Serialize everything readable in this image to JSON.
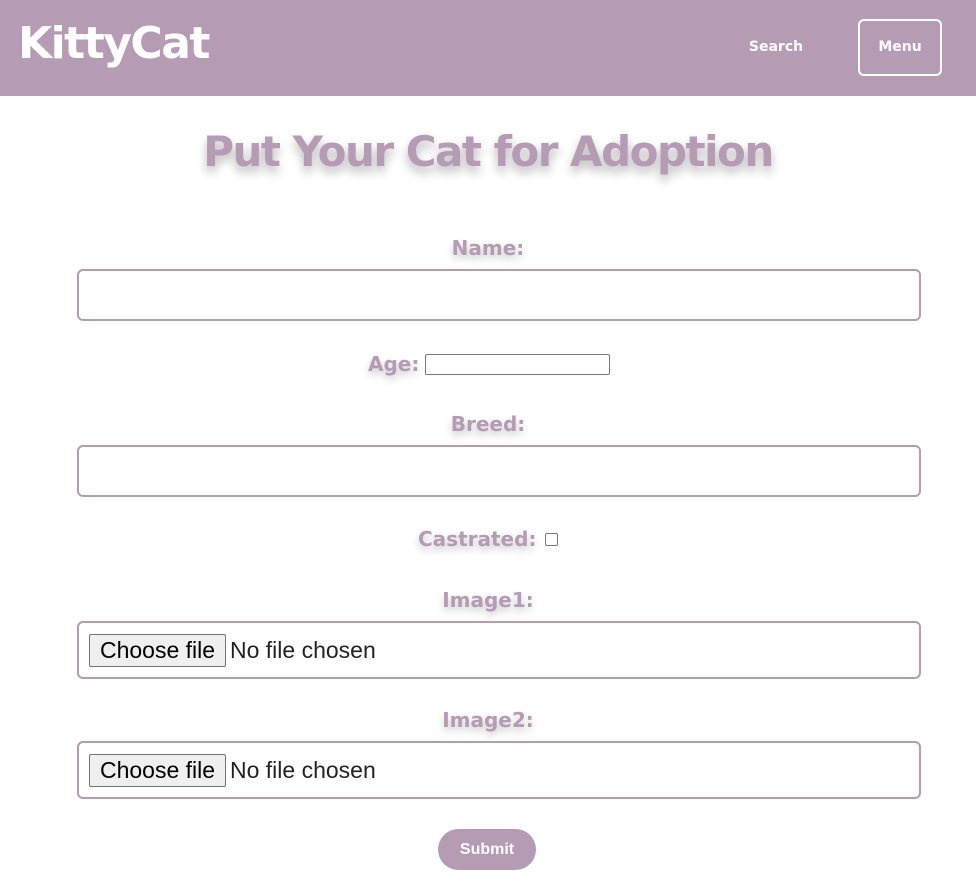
{
  "navbar": {
    "brand": "KittyCat",
    "search_label": "Search",
    "menu_label": "Menu"
  },
  "page": {
    "title": "Put Your Cat for Adoption"
  },
  "form": {
    "name_label": "Name:",
    "name_value": "",
    "age_label": "Age:",
    "age_value": "",
    "breed_label": "Breed:",
    "breed_value": "",
    "castrated_label": "Castrated:",
    "castrated_checked": false,
    "image1_label": "Image1:",
    "image2_label": "Image2:",
    "choose_file_label": "Choose file",
    "no_file_text": "No file chosen",
    "submit_label": "Submit"
  },
  "colors": {
    "accent": "#b59bb3",
    "background": "#ffffff",
    "text_on_accent": "#ffffff"
  }
}
